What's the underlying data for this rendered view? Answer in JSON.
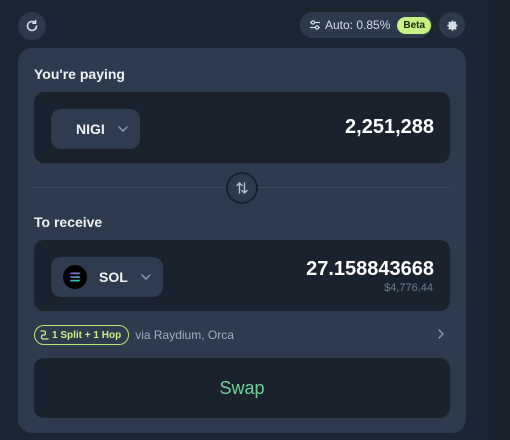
{
  "header": {
    "slippage_label": "Auto: 0.85%",
    "beta_label": "Beta"
  },
  "pay": {
    "label": "You're paying",
    "token": "NIGI",
    "amount": "2,251,288"
  },
  "receive": {
    "label": "To receive",
    "token": "SOL",
    "amount": "27.158843668",
    "usd_value": "$4,776.44"
  },
  "route": {
    "badge": "1 Split + 1 Hop",
    "via": "via Raydium, Orca"
  },
  "swap_button": {
    "label": "Swap"
  },
  "colors": {
    "background": "#1c2633",
    "card": "#2e3b4e",
    "panel": "#1a222d",
    "accent_lime": "#c7f284",
    "swap_text": "#6fcf9a"
  },
  "icons": {
    "refresh": "refresh-icon",
    "sliders": "sliders-icon",
    "settings": "gear-icon",
    "swap_direction": "arrows-up-down-icon",
    "token_chevron": "chevron-down-icon",
    "route": "route-icon",
    "route_detail": "chevron-right-icon",
    "sol_logo": "solana-logo-icon"
  }
}
